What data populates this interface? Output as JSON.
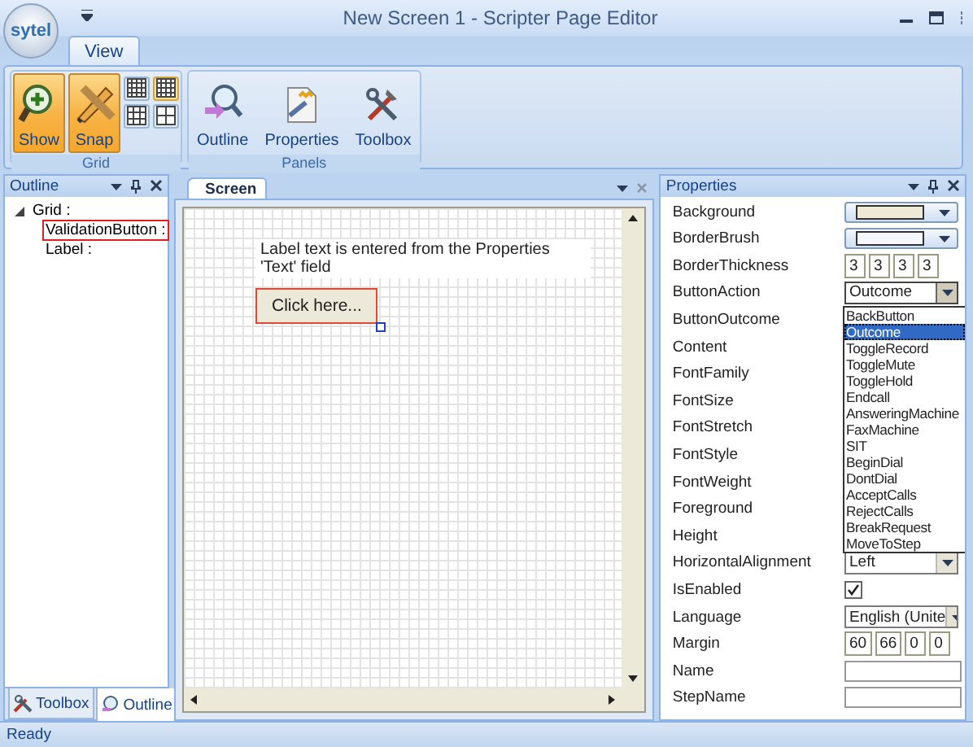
{
  "window": {
    "title": "New Screen 1 - Scripter Page Editor",
    "logo": "sytel"
  },
  "ribbon": {
    "tabs": [
      {
        "label": "View",
        "selected": true
      }
    ],
    "groups": [
      {
        "title": "Grid",
        "buttons": [
          {
            "label": "Show",
            "pressed": true
          },
          {
            "label": "Snap",
            "pressed": true
          }
        ],
        "small_buttons": [
          {
            "pressed": false
          },
          {
            "pressed": true
          },
          {
            "pressed": false
          },
          {
            "pressed": false
          }
        ]
      },
      {
        "title": "Panels",
        "buttons": [
          {
            "label": "Outline",
            "pressed": false
          },
          {
            "label": "Properties",
            "pressed": false
          },
          {
            "label": "Toolbox",
            "pressed": false
          }
        ]
      }
    ]
  },
  "outline": {
    "title": "Outline",
    "tree": [
      {
        "label": "Grid :",
        "expanded": true,
        "selected": false,
        "children": [
          {
            "label": "ValidationButton :",
            "selected": true
          },
          {
            "label": "Label :",
            "selected": false
          }
        ]
      }
    ],
    "tabs": [
      {
        "label": "Toolbox",
        "selected": false
      },
      {
        "label": "Outline",
        "selected": true
      }
    ]
  },
  "screen": {
    "tab": "Screen",
    "label_text": "Label text is entered from the Properties 'Text' field",
    "button": {
      "label": "Click here...",
      "selected": true
    }
  },
  "properties": {
    "title": "Properties",
    "rows": [
      {
        "name": "Background",
        "kind": "color",
        "color": "#efe9d8"
      },
      {
        "name": "BorderBrush",
        "kind": "color",
        "color": "#f4f7fb"
      },
      {
        "name": "BorderThickness",
        "kind": "quad",
        "values": [
          "3",
          "3",
          "3",
          "3"
        ]
      },
      {
        "name": "ButtonAction",
        "kind": "select",
        "value": "Outcome",
        "expanded": true,
        "options": [
          {
            "label": "BackButton",
            "selected": false
          },
          {
            "label": "Outcome",
            "selected": true
          },
          {
            "label": "ToggleRecord",
            "selected": false
          },
          {
            "label": "ToggleMute",
            "selected": false
          },
          {
            "label": "ToggleHold",
            "selected": false
          },
          {
            "label": "Endcall",
            "selected": false
          },
          {
            "label": "AnsweringMachine",
            "selected": false
          },
          {
            "label": "FaxMachine",
            "selected": false
          },
          {
            "label": "SIT",
            "selected": false
          },
          {
            "label": "BeginDial",
            "selected": false
          },
          {
            "label": "DontDial",
            "selected": false
          },
          {
            "label": "AcceptCalls",
            "selected": false
          },
          {
            "label": "RejectCalls",
            "selected": false
          },
          {
            "label": "BreakRequest",
            "selected": false
          },
          {
            "label": "MoveToStep",
            "selected": false
          }
        ]
      },
      {
        "name": "ButtonOutcome",
        "kind": "blank"
      },
      {
        "name": "Content",
        "kind": "blank"
      },
      {
        "name": "FontFamily",
        "kind": "blank"
      },
      {
        "name": "FontSize",
        "kind": "blank"
      },
      {
        "name": "FontStretch",
        "kind": "blank"
      },
      {
        "name": "FontStyle",
        "kind": "blank"
      },
      {
        "name": "FontWeight",
        "kind": "blank"
      },
      {
        "name": "Foreground",
        "kind": "blank"
      },
      {
        "name": "Height",
        "kind": "blank"
      },
      {
        "name": "HorizontalAlignment",
        "kind": "select",
        "value": "Left"
      },
      {
        "name": "IsEnabled",
        "kind": "check",
        "checked": true
      },
      {
        "name": "Language",
        "kind": "select",
        "value": "English (Unite"
      },
      {
        "name": "Margin",
        "kind": "quad",
        "values": [
          "60",
          "66",
          "0",
          "0"
        ]
      },
      {
        "name": "Name",
        "kind": "text"
      },
      {
        "name": "StepName",
        "kind": "text"
      }
    ]
  },
  "status_bar": {
    "text": "Ready"
  }
}
